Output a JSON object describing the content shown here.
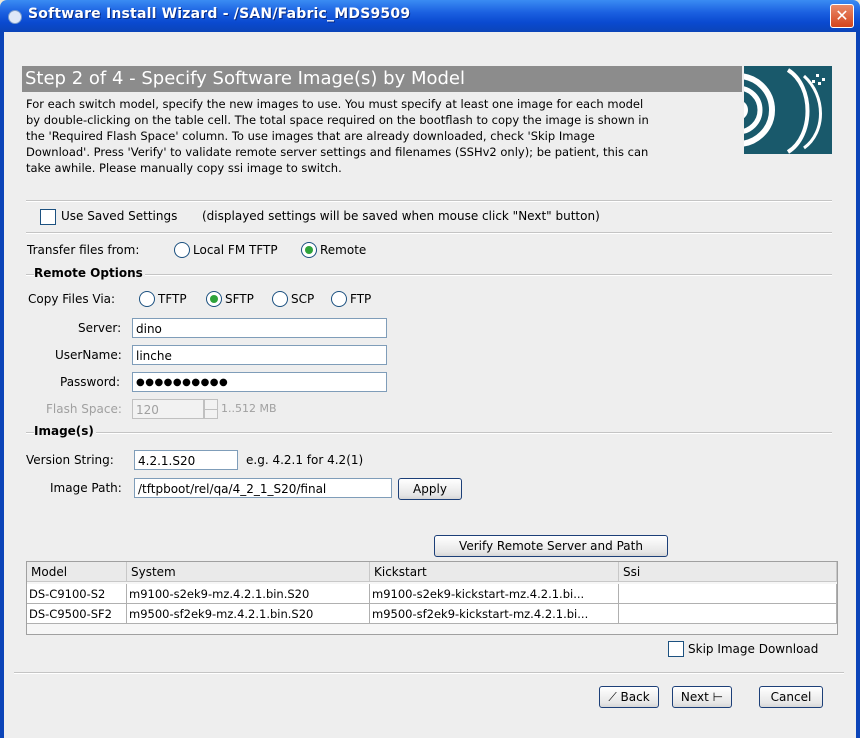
{
  "window": {
    "title": "Software Install Wizard - /SAN/Fabric_MDS9509",
    "close_glyph": "✕"
  },
  "header": {
    "step_title": "Step 2 of 4 - Specify Software Image(s) by Model",
    "logo_icon": "cisco-wizard-logo-icon"
  },
  "description": [
    "For each switch model, specify the new images to use. You must specify at least one image for each model",
    "by double-clicking on the table cell.  The total space required on the bootflash to copy the image is shown in",
    "the 'Required Flash Space' column.  To use images that are already downloaded, check 'Skip Image",
    "Download'. Press 'Verify' to validate remote server settings and filenames (SSHv2 only); be patient, this can",
    "take awhile. Please manually copy ssi image to switch."
  ],
  "saved_settings": {
    "label": "Use Saved Settings",
    "hint": "(displayed settings will be saved when mouse click \"Next\" button)",
    "checked": false
  },
  "transfer": {
    "label": "Transfer files from:",
    "options": [
      "Local FM TFTP",
      "Remote"
    ],
    "selected": "Remote"
  },
  "remote_options": {
    "section_title": "Remote Options",
    "copy_label": "Copy Files Via:",
    "copy_options": [
      "TFTP",
      "SFTP",
      "SCP",
      "FTP"
    ],
    "copy_selected": "SFTP",
    "server_label": "Server:",
    "server_value": "dino",
    "username_label": "UserName:",
    "username_value": "linche",
    "password_label": "Password:",
    "password_value": "●●●●●●●●●●",
    "flash_label": "Flash Space:",
    "flash_value": "120",
    "flash_range": "1..512 MB"
  },
  "images": {
    "section_title": "Image(s)",
    "version_label": "Version String:",
    "version_value": "4.2.1.S20",
    "version_hint": "e.g. 4.2.1 for 4.2(1)",
    "path_label": "Image Path:",
    "path_value": "/tftpboot/rel/qa/4_2_1_S20/final",
    "apply_label": "Apply"
  },
  "verify_button": "Verify Remote Server and Path",
  "table": {
    "columns": [
      "Model",
      "System",
      "Kickstart",
      "Ssi"
    ],
    "rows": [
      [
        "DS-C9100-S2",
        "m9100-s2ek9-mz.4.2.1.bin.S20",
        "m9100-s2ek9-kickstart-mz.4.2.1.bi...",
        ""
      ],
      [
        "DS-C9500-SF2",
        "m9500-sf2ek9-mz.4.2.1.bin.S20",
        "m9500-sf2ek9-kickstart-mz.4.2.1.bi...",
        ""
      ]
    ]
  },
  "skip_download": {
    "label": "Skip Image Download",
    "checked": false
  },
  "footer": {
    "back_label": "Back",
    "next_label": "Next",
    "cancel_label": "Cancel"
  }
}
